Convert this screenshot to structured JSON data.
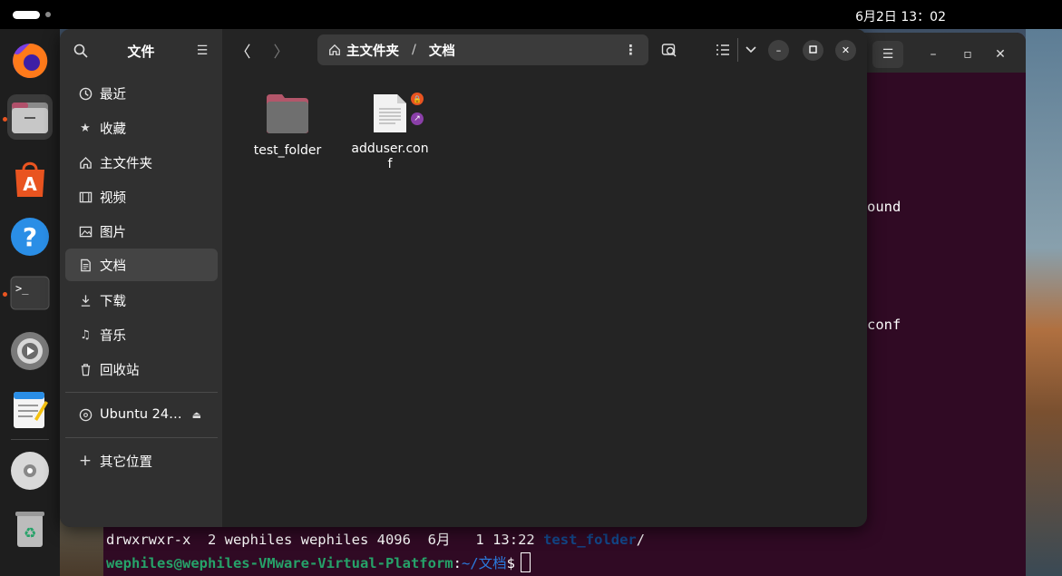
{
  "topbar": {
    "clock": "6月2日 13：02"
  },
  "dock": {
    "apps": [
      "firefox-icon",
      "files-icon",
      "app-center-icon",
      "help-icon",
      "terminal-icon",
      "settings-icon",
      "text-editor-icon",
      "dvd-icon",
      "trash-icon"
    ]
  },
  "terminal": {
    "partial_line_1": "ound",
    "partial_line_2": "conf",
    "ls_line_prefix": "drwxrwxr-x  2 wephiles wephiles 4096  6月   1 13:22 ",
    "ls_line_dir": "test_folder",
    "ls_line_suffix": "/",
    "prompt_user": "wephiles@wephiles-VMware-Virtual-Platform",
    "prompt_colon": ":",
    "prompt_path": "~/文档",
    "prompt_symbol": "$"
  },
  "files": {
    "sidebar_title": "文件",
    "sidebar_items": [
      {
        "label": "最近",
        "icon": "clock-icon"
      },
      {
        "label": "收藏",
        "icon": "star-icon"
      },
      {
        "label": "主文件夹",
        "icon": "home-icon"
      },
      {
        "label": "视频",
        "icon": "film-icon"
      },
      {
        "label": "图片",
        "icon": "image-icon"
      },
      {
        "label": "文档",
        "icon": "document-icon"
      },
      {
        "label": "下载",
        "icon": "download-icon"
      },
      {
        "label": "音乐",
        "icon": "music-icon"
      },
      {
        "label": "回收站",
        "icon": "trash-icon"
      }
    ],
    "device": "Ubuntu 24…",
    "other_locations": "其它位置",
    "path": {
      "home": "主文件夹",
      "separator": "/",
      "current": "文档"
    },
    "items": [
      {
        "name": "test_folder",
        "type": "folder"
      },
      {
        "name": "adduser.conf",
        "type": "file"
      }
    ]
  },
  "colors": {
    "terminal_bg": "#300a24",
    "files_bg": "#242424",
    "sidebar_bg": "#303030",
    "prompt_green": "#26a269",
    "dir_blue": "#2a7bde",
    "accent": "#e95420"
  }
}
